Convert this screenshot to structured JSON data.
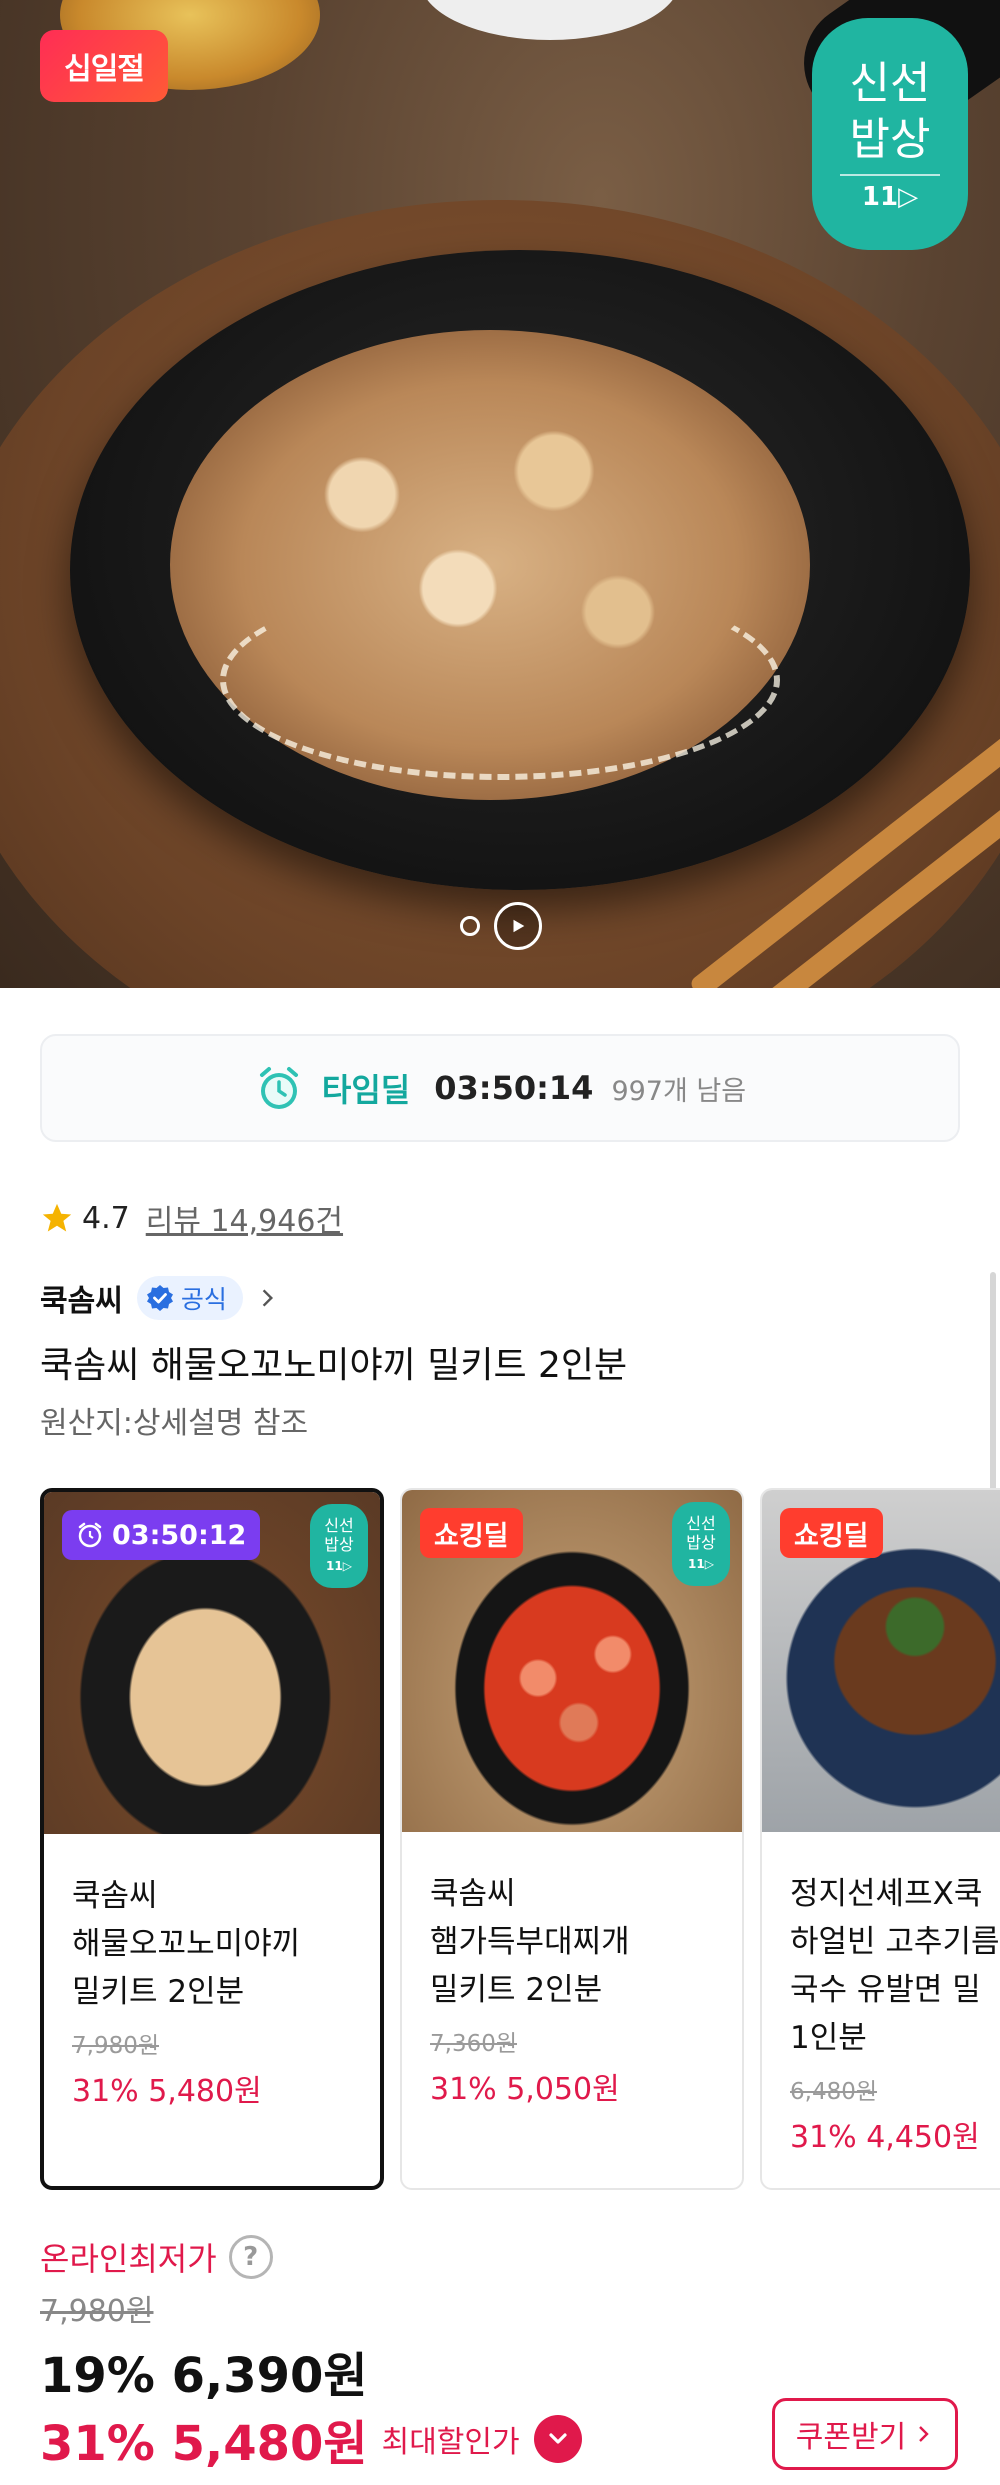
{
  "hero": {
    "badge_11": "십일절",
    "fresh_badge": {
      "line1": "신선",
      "line2": "밥상",
      "line3": "11▷"
    }
  },
  "timedeal": {
    "label": "타임딜",
    "time": "03:50:14",
    "remaining": "997개 남음"
  },
  "rating": {
    "score": "4.7",
    "reviews": "리뷰 14,946건"
  },
  "seller": {
    "name": "쿡솜씨",
    "official": "공식"
  },
  "product": {
    "title": "쿡솜씨 해물오꼬노미야끼 밀키트 2인분",
    "origin": "원산지:상세설명 참조"
  },
  "cards": [
    {
      "tag": "03:50:12",
      "name": "쿡솜씨\n해물오꼬노미야끼\n밀키트 2인분",
      "original_price": "7,980원",
      "sale": "31% 5,480원",
      "mini_fresh": {
        "l1": "신선",
        "l2": "밥상",
        "l3": "11▷"
      }
    },
    {
      "tag": "쇼킹딜",
      "name": "쿡솜씨\n햄가득부대찌개\n밀키트 2인분",
      "original_price": "7,360원",
      "sale": "31% 5,050원",
      "mini_fresh": {
        "l1": "신선",
        "l2": "밥상",
        "l3": "11▷"
      }
    },
    {
      "tag": "쇼킹딜",
      "name": "정지선셰프X쿡\n하얼빈 고추기름\n국수 유발면 밀\n1인분",
      "original_price": "6,480원",
      "sale": "31% 4,450원"
    }
  ],
  "price": {
    "lowest_label": "온라인최저가",
    "qmark": "?",
    "original": "7,980원",
    "discount_19": "19% 6,390원",
    "discount_31": "31% 5,480원",
    "max_discount_label": "최대할인가",
    "coupon_button": "쿠폰받기"
  },
  "colors": {
    "accent": "#e0194b",
    "teal": "#20b5a1",
    "timedeal_teal": "#13a89e",
    "purple": "#7b3df0",
    "shocking": "#ff3d2e"
  }
}
